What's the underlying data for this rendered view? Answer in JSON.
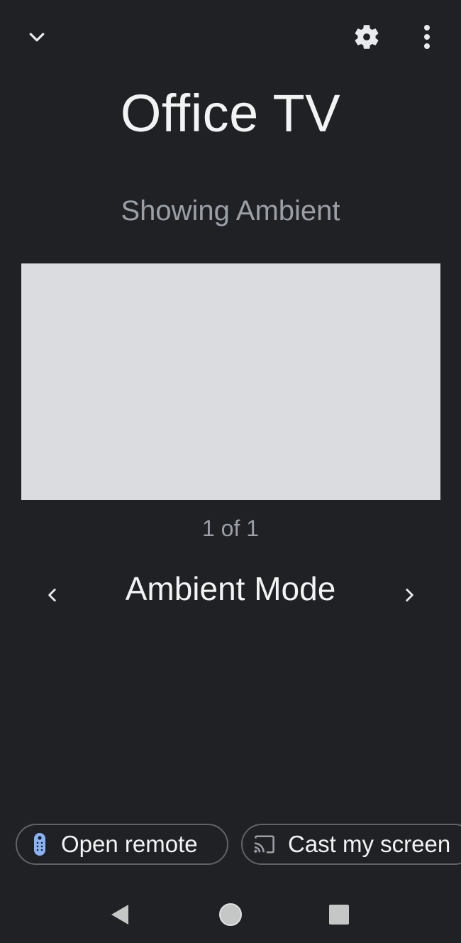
{
  "header": {
    "collapse_icon": "chevron-down-icon",
    "settings_icon": "gear-icon",
    "more_icon": "more-vert-icon"
  },
  "device": {
    "name": "Office TV",
    "status": "Showing Ambient"
  },
  "carousel": {
    "counter": "1 of 1",
    "mode_label": "Ambient Mode",
    "prev_icon": "chevron-left-icon",
    "next_icon": "chevron-right-icon"
  },
  "actions": {
    "open_remote_label": "Open remote",
    "open_remote_icon": "remote-icon",
    "cast_label": "Cast my screen",
    "cast_icon": "cast-icon"
  },
  "system_nav": {
    "back_icon": "back-triangle-icon",
    "home_icon": "home-circle-icon",
    "recents_icon": "recents-square-icon"
  },
  "colors": {
    "background": "#202124",
    "preview_fill": "#dadce0",
    "accent_blue": "#8ab4f8",
    "muted_text": "#9aa0a6"
  }
}
